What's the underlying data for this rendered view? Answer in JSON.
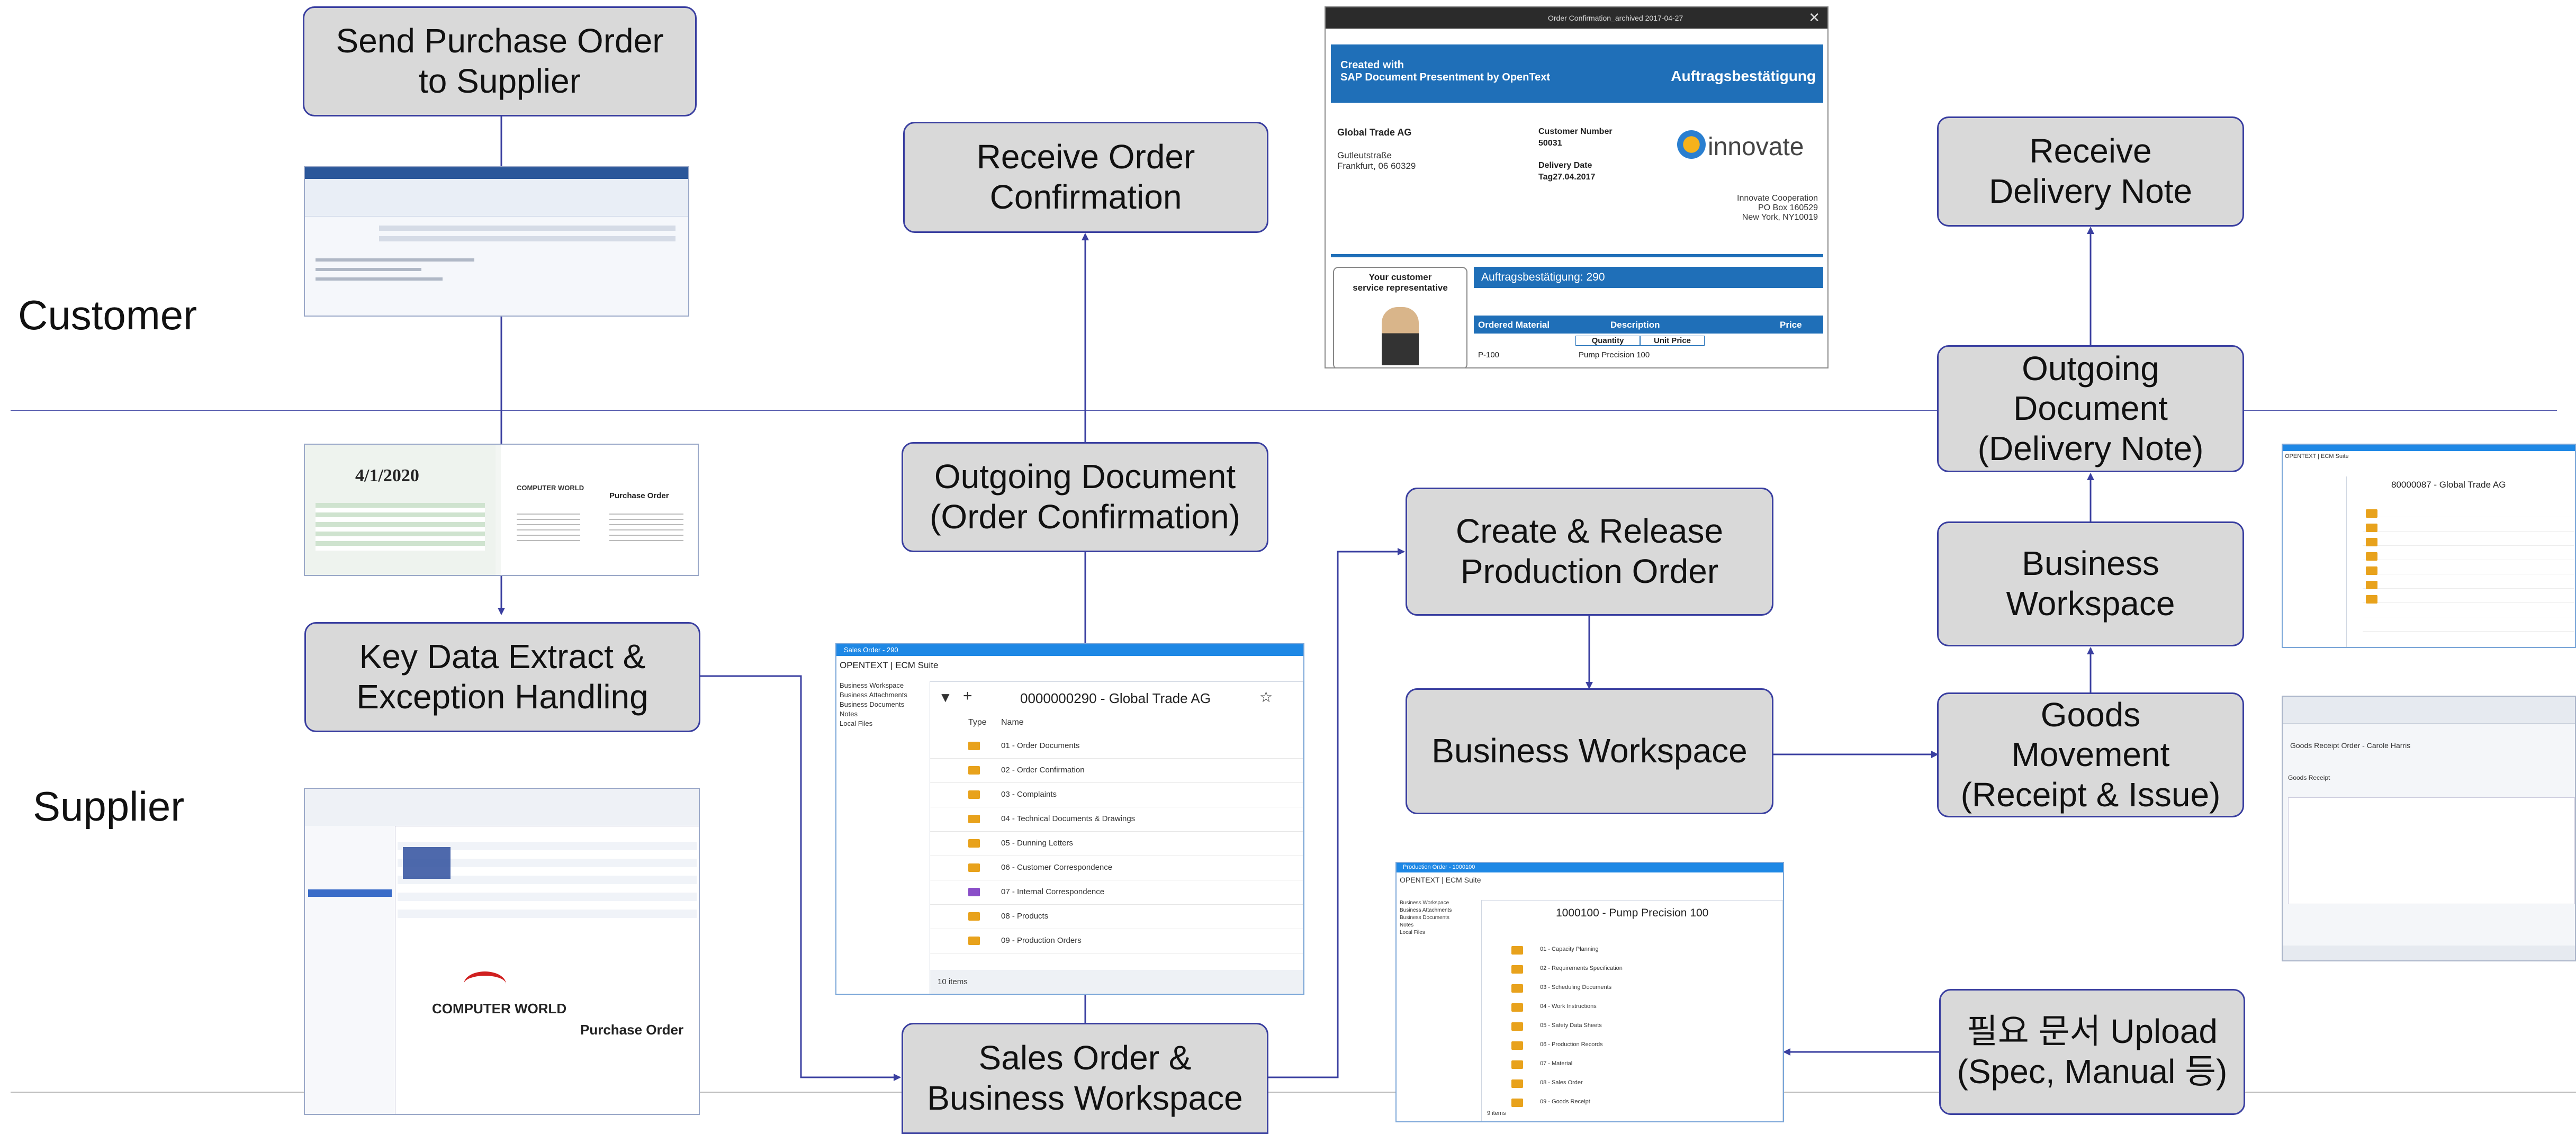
{
  "lanes": {
    "customer": "Customer",
    "supplier": "Supplier"
  },
  "boxes": {
    "send_po": "Send Purchase Order\nto Supplier",
    "receive_oc": "Receive Order\nConfirmation",
    "receive_dn": "Receive\nDelivery Note",
    "outgoing_dn": "Outgoing\nDocument\n(Delivery Note)",
    "outgoing_oc": "Outgoing Document\n(Order Confirmation)",
    "create_release": "Create & Release\nProduction Order",
    "bw_supplier": "Business\nWorkspace",
    "key_data": "Key Data Extract &\nException Handling",
    "bw_main": "Business Workspace",
    "goods_movement": "Goods\nMovement\n(Receipt & Issue)",
    "sales_order": "Sales Order &\nBusiness Workspace",
    "upload": "필요 문서 Upload\n(Spec, Manual 등)"
  },
  "pdf": {
    "toolbar_title": "Order Confirmation_archived 2017-04-27",
    "created_with": "Created with\nSAP Document Presentment by OpenText",
    "doc_type": "Auftragsbestätigung",
    "sender_name": "Global Trade AG",
    "sender_address": "Gutleutstraße\nFrankfurt, 06 60329",
    "customer_number_label": "Customer Number",
    "customer_number": "50031",
    "delivery_date_label": "Delivery Date",
    "delivery_date": "Tag27.04.2017",
    "logo_text": "innovate",
    "recipient_address": "Innovate Cooperation\nPO Box 160529\nNew York, NY10019",
    "rep_label": "Your customer\nservice representative",
    "confirmation_title": "Auftragsbestätigung: 290",
    "col_material": "Ordered Material",
    "col_description": "Description",
    "col_price": "Price",
    "col_quantity": "Quantity",
    "col_unit_price": "Unit Price",
    "row_material": "P-100",
    "row_description": "Pump Precision 100"
  },
  "scan": {
    "date": "4/1/2020",
    "company": "COMPUTER WORLD",
    "doc_title": "Purchase Order"
  },
  "ecm_sales": {
    "window_title": "Sales Order - 290",
    "brand": "OPENTEXT | ECM Suite",
    "header": "0000000290 - Global Trade AG",
    "nav": [
      "Business Workspace",
      "Business Attachments",
      "Business Documents",
      "Notes",
      "Local Files"
    ],
    "col_type": "Type",
    "col_name": "Name",
    "rows": [
      "01 - Order Documents",
      "02 - Order Confirmation",
      "03 - Complaints",
      "04 - Technical Documents & Drawings",
      "05 - Dunning Letters",
      "06 - Customer Correspondence",
      "07 - Internal Correspondence",
      "08 - Products",
      "09 - Production Orders"
    ],
    "footer": "10 items"
  },
  "ecm_prod": {
    "window_title": "Production Order - 1000100",
    "brand": "OPENTEXT | ECM Suite",
    "header": "1000100 - Pump Precision 100",
    "nav": [
      "Business Workspace",
      "Business Attachments",
      "Business Documents",
      "Notes",
      "Local Files"
    ],
    "rows": [
      "01 - Capacity Planning",
      "02 - Requirements Specification",
      "03 - Scheduling Documents",
      "04 - Work Instructions",
      "05 - Safety Data Sheets",
      "06 - Production Records",
      "07 - Material",
      "08 - Sales Order",
      "09 - Goods Receipt"
    ],
    "footer": "9 items"
  },
  "ecm_right": {
    "brand": "OPENTEXT | ECM Suite",
    "header": "80000087 - Global Trade AG"
  },
  "sap_gr": {
    "title": "Goods Receipt Order - Carole Harris",
    "status": "Goods Receipt"
  },
  "colors": {
    "line": "#3a3fa0",
    "box_fill": "#d9d9d9",
    "accent": "#1f6fb8",
    "folder": "#e8a21c"
  }
}
